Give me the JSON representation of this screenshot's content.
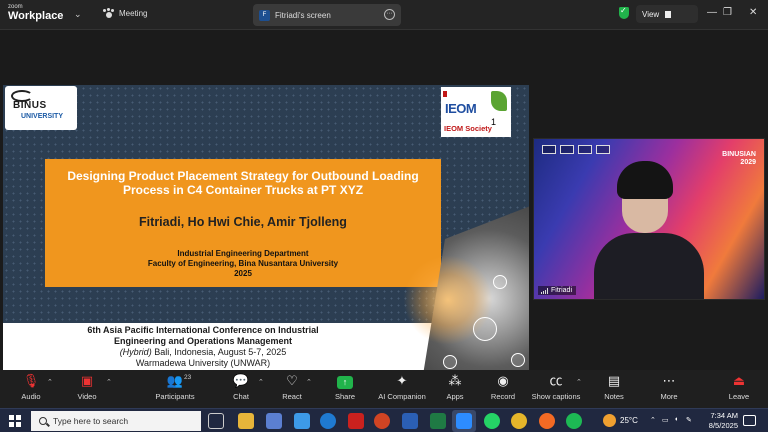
{
  "titlebar": {
    "brand_small": "zoom",
    "brand_big": "Workplace",
    "meeting_tab": "Meeting",
    "screen_badge": "F",
    "screen_tab": "Fitriadi's screen",
    "view_label": "View",
    "icons": [
      "chevron-down-icon",
      "paw-icon",
      "more-icon",
      "shield-check-icon",
      "minimize-icon",
      "restore-icon",
      "close-icon"
    ]
  },
  "slide": {
    "logo_left_line1": "BINUS",
    "logo_left_line2": "UNIVERSITY",
    "logo_right_line1": "IEOM",
    "logo_right_line2": "IEOM Society",
    "logo_right_number": "1",
    "title": "Designing Product Placement Strategy for Outbound Loading Process in C4 Container Trucks at PT XYZ",
    "authors": "Fitriadi, Ho Hwi Chie, Amir Tjolleng",
    "dept_line1": "Industrial Engineering Department",
    "dept_line2": "Faculty of Engineering, Bina Nusantara University",
    "dept_year": "2025",
    "conf_line1": "6th Asia Pacific International Conference on Industrial",
    "conf_line2": "Engineering and Operations Management",
    "conf_line3_italic": "(Hybrid)",
    "conf_line3_rest": " Bali, Indonesia, August 5-7, 2025",
    "conf_line4": "Warmadewa University (UNWAR)"
  },
  "video": {
    "participant_name": "Fitriadi",
    "bg_text_line1": "BINUSIAN",
    "bg_text_line2": "2029"
  },
  "toolbar": {
    "audio": "Audio",
    "video": "Video",
    "participants": "Participants",
    "participants_count": "23",
    "chat": "Chat",
    "react": "React",
    "share": "Share",
    "ai_companion": "AI Companion",
    "apps": "Apps",
    "record": "Record",
    "show_captions": "Show captions",
    "notes": "Notes",
    "more": "More",
    "leave": "Leave"
  },
  "taskbar": {
    "search_placeholder": "Type here to search",
    "temperature": "25°C",
    "time": "7:34 AM",
    "date": "8/5/2025",
    "colors": {
      "edge": "#1f7ad1",
      "chrome": "#e5b52a",
      "excel": "#1f7a44",
      "whatsapp": "#25d366",
      "spotify": "#1db954",
      "firefox": "#f36a24",
      "pdf": "#c9211e"
    }
  }
}
